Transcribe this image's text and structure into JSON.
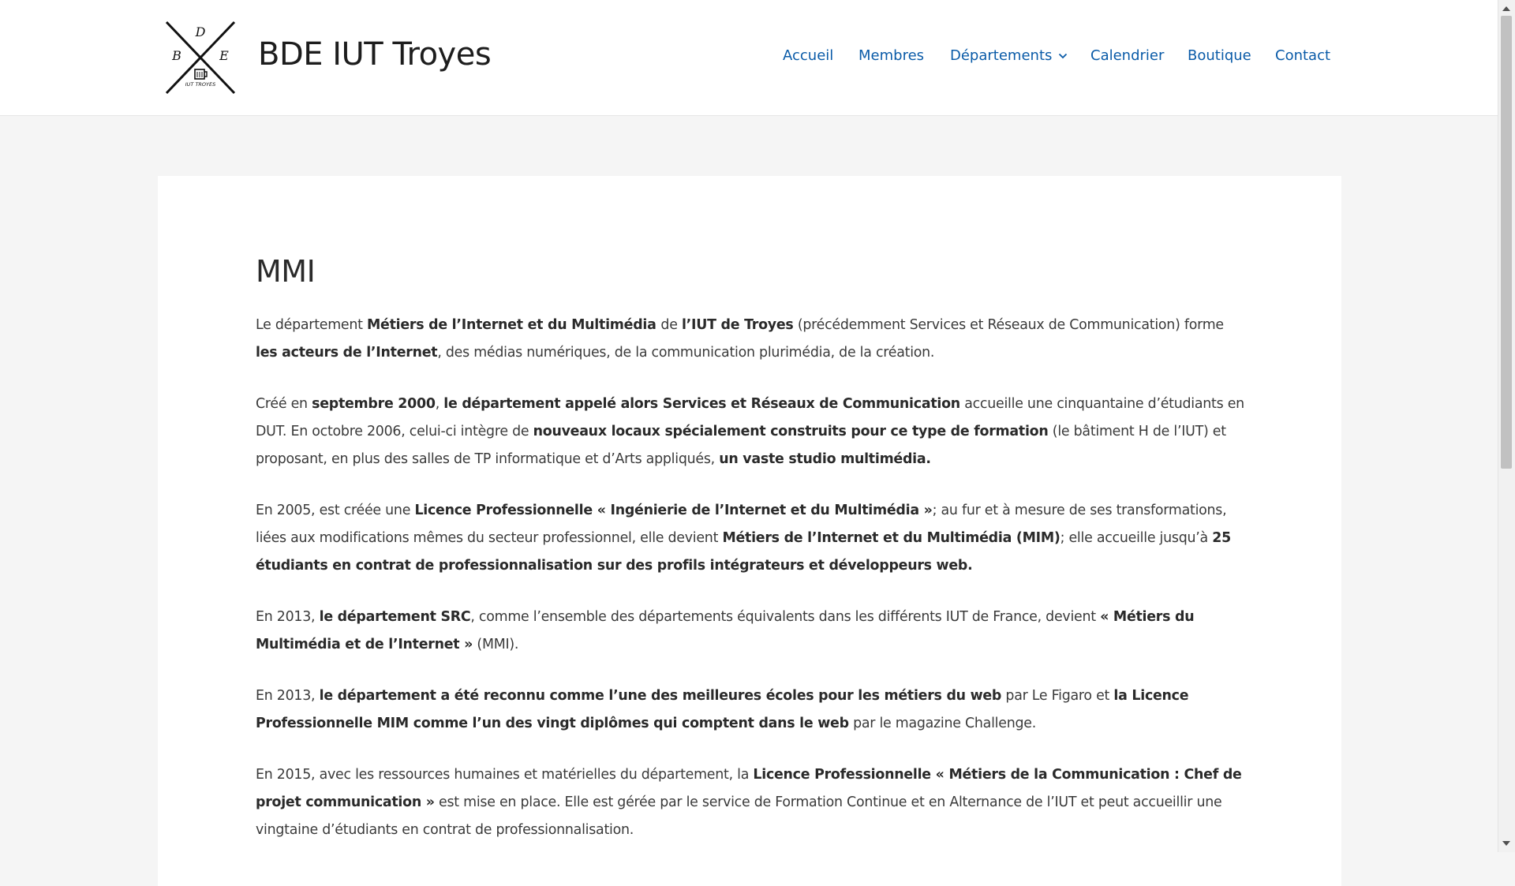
{
  "site": {
    "title": "BDE IUT Troyes",
    "logo_letters": [
      "D",
      "B",
      "E"
    ],
    "logo_caption": "IUT TROYES"
  },
  "nav": {
    "items": [
      "Accueil",
      "Membres",
      "Départements",
      "Calendrier",
      "Boutique",
      "Contact"
    ]
  },
  "page": {
    "title": "MMI",
    "paragraphs": [
      [
        {
          "t": "Le département "
        },
        {
          "t": " Métiers de l’Internet et du Multimédia ",
          "b": true
        },
        {
          "t": " de "
        },
        {
          "t": "l’IUT de Troyes",
          "b": true
        },
        {
          "t": " (précédemment Services et Réseaux de Communication) forme "
        },
        {
          "t": "les acteurs de l’Internet",
          "b": true
        },
        {
          "t": ", des médias numériques, de la communication plurimédia, de la création."
        }
      ],
      [
        {
          "t": "Créé en "
        },
        {
          "t": "septembre 2000",
          "b": true
        },
        {
          "t": ", "
        },
        {
          "t": "le département appelé alors Services et Réseaux de Communication",
          "b": true
        },
        {
          "t": " accueille une cinquantaine d’étudiants en DUT. En octobre 2006, celui-ci intègre de "
        },
        {
          "t": "nouveaux locaux spécialement construits pour ce type de formation",
          "b": true
        },
        {
          "t": " (le bâtiment H de l’IUT) et proposant, en plus des salles de TP informatique et d’Arts appliqués, "
        },
        {
          "t": "un vaste studio multimédia.",
          "b": true
        }
      ],
      [
        {
          "t": "En 2005, est créée une "
        },
        {
          "t": " Licence Professionnelle « Ingénierie de l’Internet et du Multimédia »",
          "b": true
        },
        {
          "t": "; au fur et à mesure de ses transformations, liées aux modifications mêmes du secteur professionnel, elle devient "
        },
        {
          "t": "Métiers de l’Internet et du Multimédia (MIM)",
          "b": true
        },
        {
          "t": "; elle accueille jusqu’à "
        },
        {
          "t": "25 étudiants en contrat de professionnalisation sur des profils intégrateurs et développeurs web.",
          "b": true
        }
      ],
      [
        {
          "t": "En 2013, "
        },
        {
          "t": "le département SRC",
          "b": true
        },
        {
          "t": ", comme l’ensemble des départements équivalents dans les différents IUT de France, devient "
        },
        {
          "t": "« Métiers du Multimédia et de l’Internet »",
          "b": true
        },
        {
          "t": " (MMI)."
        }
      ],
      [
        {
          "t": "En 2013, "
        },
        {
          "t": "le département a été reconnu comme l’une des meilleures écoles pour les métiers du web",
          "b": true
        },
        {
          "t": " par Le Figaro et "
        },
        {
          "t": "la Licence Professionnelle MIM comme l’un des vingt diplômes qui comptent dans le web",
          "b": true
        },
        {
          "t": " par le magazine Challenge."
        }
      ],
      [
        {
          "t": "En 2015, avec les ressources humaines et matérielles du département, la "
        },
        {
          "t": " Licence Professionnelle « Métiers de la Communication : Chef de projet communication »",
          "b": true
        },
        {
          "t": " est mise en place. Elle est gérée par le service de Formation Continue et en Alternance de l’IUT et peut accueillir une vingtaine d’étudiants en contrat de professionnalisation."
        }
      ]
    ]
  },
  "colors": {
    "link": "#0a5ba8",
    "background": "#f5f5f5",
    "card": "#ffffff",
    "text": "#3a3a3a"
  },
  "icons": [
    "site-logo-icon",
    "chevron-down-icon",
    "scroll-up-arrow-icon",
    "scroll-down-arrow-icon"
  ]
}
